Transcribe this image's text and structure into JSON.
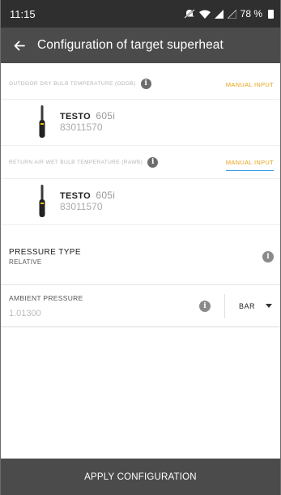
{
  "status_bar": {
    "time": "11:15",
    "battery": "78 %",
    "icons": [
      "mute-icon",
      "wifi-icon",
      "signal-icon",
      "battery-icon"
    ]
  },
  "app_bar": {
    "title": "Configuration of target superheat",
    "back_icon": "arrow-left-icon"
  },
  "outdoor_section": {
    "label": "Outdoor dry bulb temperature (ODDB)",
    "action": "Manual input",
    "device": {
      "brand": "TESTO",
      "model": "605i",
      "serial": "83011570"
    }
  },
  "return_section": {
    "label": "Return air wet bulb temperature (RAWB)",
    "action": "Manual input",
    "device": {
      "brand": "TESTO",
      "model": "605i",
      "serial": "83011570"
    }
  },
  "pressure_type": {
    "label": "Pressure type",
    "value": "Relative"
  },
  "ambient_pressure": {
    "label": "Ambient pressure",
    "value": "1.01300",
    "unit": "bar"
  },
  "apply_button": {
    "label": "APPLY CONFIGURATION"
  },
  "colors": {
    "status_bar": "#2f2f2f",
    "app_bar": "#4b4b4b",
    "accent_link": "#e8a21a",
    "underline": "#3aa0e8"
  }
}
